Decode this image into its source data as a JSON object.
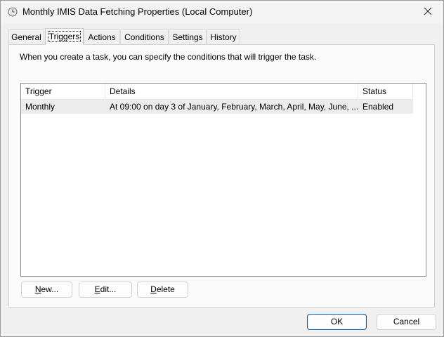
{
  "window": {
    "title": "Monthly IMIS Data Fetching Properties (Local Computer)"
  },
  "tabs": [
    {
      "label": "General",
      "active": false
    },
    {
      "label": "Triggers",
      "active": true
    },
    {
      "label": "Actions",
      "active": false
    },
    {
      "label": "Conditions",
      "active": false
    },
    {
      "label": "Settings",
      "active": false
    },
    {
      "label": "History",
      "active": false
    }
  ],
  "triggers": {
    "description": "When you create a task, you can specify the conditions that will trigger the task.",
    "columns": [
      "Trigger",
      "Details",
      "Status"
    ],
    "rows": [
      {
        "trigger": "Monthly",
        "details": "At 09:00  on day 3 of January, February, March, April, May, June, ...",
        "status": "Enabled"
      }
    ],
    "buttons": {
      "new_u": "N",
      "new_rest": "ew...",
      "edit_u": "E",
      "edit_rest": "dit...",
      "delete_u": "D",
      "delete_rest": "elete"
    }
  },
  "footer": {
    "ok": "OK",
    "cancel": "Cancel"
  }
}
